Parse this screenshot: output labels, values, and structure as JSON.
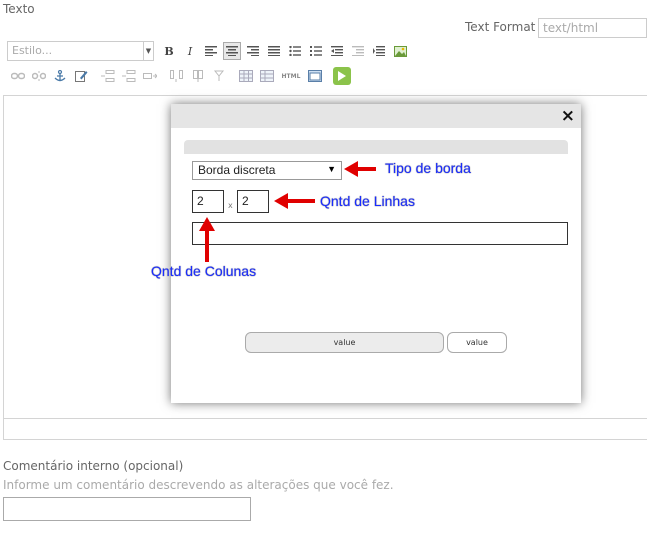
{
  "field": {
    "label": "Texto"
  },
  "text_format": {
    "label": "Text Format",
    "value": "text/html"
  },
  "toolbar": {
    "style_select": "Estilo...",
    "bold": "B",
    "italic": "I",
    "html_button": "HTML"
  },
  "dialog": {
    "close": "×",
    "border_select": "Borda discreta",
    "rows": "2",
    "cols": "2",
    "times": "x",
    "ok": "value",
    "cancel": "value"
  },
  "annotations": {
    "border_type": "Tipo de borda",
    "rows": "Qntd de Linhas",
    "cols": "Qntd de Colunas"
  },
  "comment": {
    "label": "Comentário interno (opcional)",
    "help": "Informe um comentário descrevendo as alterações que você fez.",
    "value": ""
  },
  "colors": {
    "annotation": "#1a2cff",
    "arrow": "#e00000",
    "play": "#8bc34a"
  }
}
